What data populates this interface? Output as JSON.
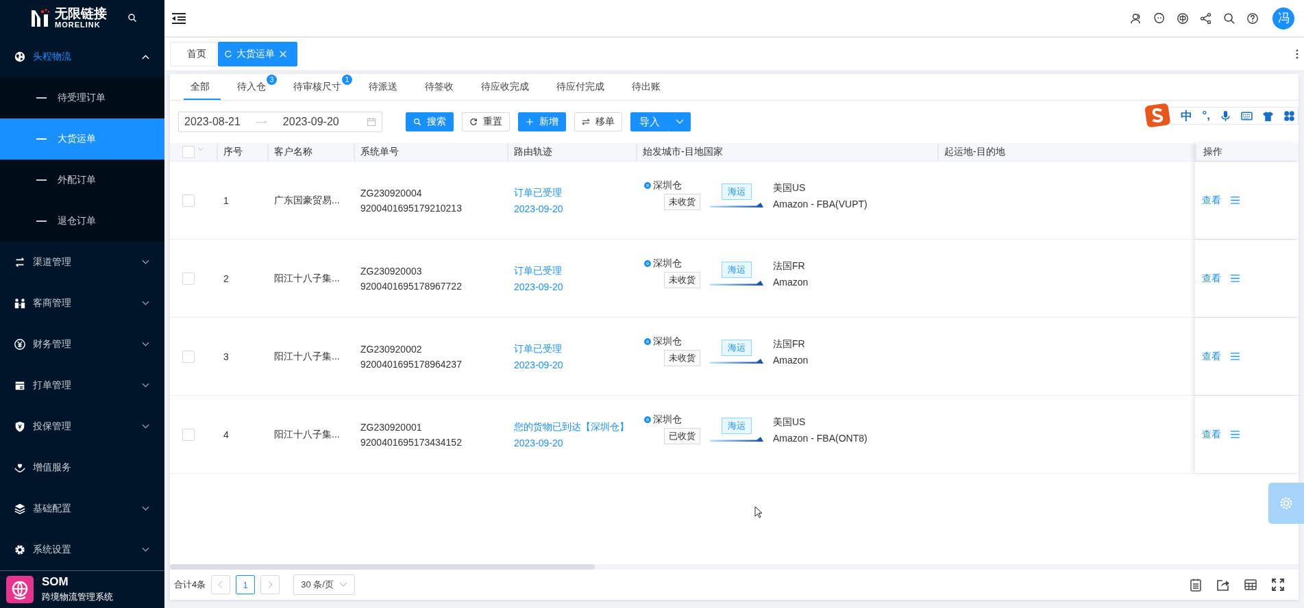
{
  "sidebar": {
    "logo": {
      "name": "无限链接",
      "sub": "MORELINK"
    },
    "items": [
      {
        "label": "头程物流",
        "expanded": true,
        "children": [
          {
            "label": "待受理订单",
            "selected": false
          },
          {
            "label": "大货运单",
            "selected": true
          },
          {
            "label": "外配订单",
            "selected": false
          },
          {
            "label": "退仓订单",
            "selected": false
          }
        ]
      },
      {
        "label": "渠道管理",
        "expanded": false
      },
      {
        "label": "客商管理",
        "expanded": false
      },
      {
        "label": "财务管理",
        "expanded": false
      },
      {
        "label": "打单管理",
        "expanded": false
      },
      {
        "label": "投保管理",
        "expanded": false
      },
      {
        "label": "增值服务"
      },
      {
        "label": "基础配置",
        "expanded": false
      },
      {
        "label": "系统设置",
        "expanded": false
      }
    ],
    "footer": {
      "title": "SOM",
      "subtitle": "跨境物流管理系统"
    }
  },
  "header": {
    "avatar": "冯"
  },
  "page_tabs": [
    {
      "label": "首页",
      "selected": false
    },
    {
      "label": "大货运单",
      "selected": true
    }
  ],
  "status_tabs": [
    {
      "label": "全部",
      "selected": true
    },
    {
      "label": "待入仓",
      "badge": "3",
      "selected": false
    },
    {
      "label": "待审核尺寸",
      "badge": "1",
      "selected": false
    },
    {
      "label": "待派送",
      "selected": false
    },
    {
      "label": "待签收",
      "selected": false
    },
    {
      "label": "待应收完成",
      "selected": false
    },
    {
      "label": "待应付完成",
      "selected": false
    },
    {
      "label": "待出账",
      "selected": false
    }
  ],
  "filters": {
    "start_date": "2023-08-21",
    "end_date": "2023-09-20"
  },
  "buttons": [
    {
      "label": "搜索",
      "kind": "primary"
    },
    {
      "label": "重置",
      "kind": "default"
    },
    {
      "label": "新增",
      "kind": "primary"
    },
    {
      "label": "移单",
      "kind": "default"
    },
    {
      "label": "导入",
      "kind": "split"
    }
  ],
  "ime_toolbar": {
    "mode": "中",
    "punct": "°,"
  },
  "table": {
    "all_selected": false,
    "columns": [
      "序号",
      "客户名称",
      "系统单号",
      "路由轨迹",
      "始发城市-目地国家",
      "起运地-目的地",
      "操作"
    ],
    "rows": [
      {
        "selected": false,
        "index": "1",
        "customer": "广东国豪贸易...",
        "order_no": "ZG230920004",
        "tracking_no": "9200401695179210213",
        "route_status": "订单已受理",
        "route_date": "2023-09-20",
        "warehouse": "深圳仓",
        "warehouse_checked": true,
        "receipt": "未收货",
        "transport": "海运",
        "country": "美国US",
        "destination": "Amazon - FBA(VUPT)",
        "actions": [
          "查看"
        ]
      },
      {
        "selected": false,
        "index": "2",
        "customer": "阳江十八子集...",
        "order_no": "ZG230920003",
        "tracking_no": "9200401695178967722",
        "route_status": "订单已受理",
        "route_date": "2023-09-20",
        "warehouse": "深圳仓",
        "warehouse_checked": true,
        "receipt": "未收货",
        "transport": "海运",
        "country": "法国FR",
        "destination": "Amazon",
        "actions": [
          "查看"
        ]
      },
      {
        "selected": false,
        "index": "3",
        "customer": "阳江十八子集...",
        "order_no": "ZG230920002",
        "tracking_no": "9200401695178964237",
        "route_status": "订单已受理",
        "route_date": "2023-09-20",
        "warehouse": "深圳仓",
        "warehouse_checked": true,
        "receipt": "未收货",
        "transport": "海运",
        "country": "法国FR",
        "destination": "Amazon",
        "actions": [
          "查看"
        ]
      },
      {
        "selected": false,
        "index": "4",
        "customer": "阳江十八子集...",
        "order_no": "ZG230920001",
        "tracking_no": "9200401695173434152",
        "route_status": "您的货物已到达【深圳仓】",
        "route_date": "2023-09-20",
        "warehouse": "深圳仓",
        "warehouse_checked": true,
        "receipt": "已收货",
        "transport": "海运",
        "country": "美国US",
        "destination": "Amazon - FBA(ONT8)",
        "actions": [
          "查看"
        ]
      }
    ]
  },
  "pagination": {
    "total": "合计4条",
    "pages": [
      {
        "label": "1",
        "selected": true
      }
    ],
    "page_size": "30 条/页"
  }
}
